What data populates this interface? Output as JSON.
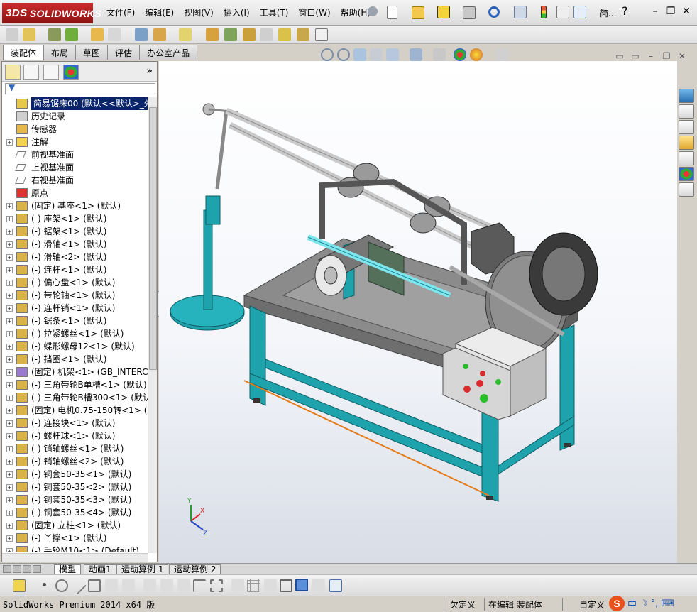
{
  "app": {
    "logo_text": "SOLIDWORKS",
    "logo_prefix": "3DS"
  },
  "menus": [
    "文件(F)",
    "编辑(E)",
    "视图(V)",
    "插入(I)",
    "工具(T)",
    "窗口(W)",
    "帮助(H)"
  ],
  "title_extra": "简...",
  "command_tabs": [
    {
      "label": "装配体",
      "active": true
    },
    {
      "label": "布局",
      "active": false
    },
    {
      "label": "草图",
      "active": false
    },
    {
      "label": "评估",
      "active": false
    },
    {
      "label": "办公室产品",
      "active": false
    }
  ],
  "feature_tree": [
    {
      "label": "简易锯床00 (默认<<默认>_外观",
      "icon": "assembly-icon",
      "root": true
    },
    {
      "label": "历史记录",
      "icon": "history-icon",
      "expand": false
    },
    {
      "label": "传感器",
      "icon": "sensor-icon",
      "expand": false
    },
    {
      "label": "注解",
      "icon": "annotation-icon",
      "expand": true
    },
    {
      "label": "前视基准面",
      "icon": "plane-icon",
      "expand": false
    },
    {
      "label": "上视基准面",
      "icon": "plane-icon",
      "expand": false
    },
    {
      "label": "右视基准面",
      "icon": "plane-icon",
      "expand": false
    },
    {
      "label": "原点",
      "icon": "origin-icon",
      "expand": false
    },
    {
      "label": "(固定) 基座<1> (默认)",
      "icon": "part-icon",
      "expand": true
    },
    {
      "label": "(-) 座架<1> (默认)",
      "icon": "part-icon",
      "expand": true
    },
    {
      "label": "(-) 锯架<1> (默认)",
      "icon": "part-icon",
      "expand": true
    },
    {
      "label": "(-) 滑轴<1> (默认)",
      "icon": "part-icon",
      "expand": true
    },
    {
      "label": "(-) 滑轴<2> (默认)",
      "icon": "part-icon",
      "expand": true
    },
    {
      "label": "(-) 连杆<1> (默认)",
      "icon": "part-icon",
      "expand": true
    },
    {
      "label": "(-) 偏心盘<1> (默认)",
      "icon": "part-icon",
      "expand": true
    },
    {
      "label": "(-) 带轮轴<1> (默认)",
      "icon": "part-icon",
      "expand": true
    },
    {
      "label": "(-) 连杆销<1> (默认)",
      "icon": "part-icon",
      "expand": true
    },
    {
      "label": "(-) 锯条<1> (默认)",
      "icon": "part-icon",
      "expand": true
    },
    {
      "label": "(-) 拉紧螺丝<1> (默认)",
      "icon": "part-icon",
      "expand": true
    },
    {
      "label": "(-) 蝶形螺母12<1> (默认)",
      "icon": "part-icon",
      "expand": true
    },
    {
      "label": "(-) 挡圈<1> (默认)",
      "icon": "part-icon",
      "expand": true
    },
    {
      "label": "(固定) 机架<1> (GB_INTERCHA",
      "icon": "subassembly-icon",
      "expand": true
    },
    {
      "label": "(-) 三角带轮B单槽<1> (默认)",
      "icon": "part-icon",
      "expand": true
    },
    {
      "label": "(-) 三角带轮B槽300<1> (默认",
      "icon": "part-icon",
      "expand": true
    },
    {
      "label": "(固定) 电机0.75-150转<1> (默",
      "icon": "part-icon",
      "expand": true
    },
    {
      "label": "(-) 连接块<1> (默认)",
      "icon": "part-icon",
      "expand": true
    },
    {
      "label": "(-) 螺杆球<1> (默认)",
      "icon": "part-icon",
      "expand": true
    },
    {
      "label": "(-) 销轴螺丝<1> (默认)",
      "icon": "part-icon",
      "expand": true
    },
    {
      "label": "(-) 销轴螺丝<2> (默认)",
      "icon": "part-icon",
      "expand": true
    },
    {
      "label": "(-) 铜套50-35<1> (默认)",
      "icon": "part-icon",
      "expand": true
    },
    {
      "label": "(-) 铜套50-35<2> (默认)",
      "icon": "part-icon",
      "expand": true
    },
    {
      "label": "(-) 铜套50-35<3> (默认)",
      "icon": "part-icon",
      "expand": true
    },
    {
      "label": "(-) 铜套50-35<4> (默认)",
      "icon": "part-icon",
      "expand": true
    },
    {
      "label": "(固定) 立柱<1> (默认)",
      "icon": "part-icon",
      "expand": true
    },
    {
      "label": "(-) 丫撑<1> (默认)",
      "icon": "part-icon",
      "expand": true
    },
    {
      "label": "(-) 手轮M10<1> (Default)",
      "icon": "part-icon",
      "expand": true
    }
  ],
  "bottom_tabs": [
    {
      "label": "模型",
      "active": true
    },
    {
      "label": "动画1",
      "active": false
    },
    {
      "label": "运动算例 1",
      "active": false
    },
    {
      "label": "运动算例 2",
      "active": false
    }
  ],
  "status": {
    "product": "SolidWorks Premium 2014 x64 版",
    "underdefined": "欠定义",
    "editing": "在编辑 装配体",
    "custom": "自定义"
  },
  "ime": {
    "logo": "S",
    "lang": "中"
  },
  "triad": {
    "x": "X",
    "y": "Y",
    "z": "Z"
  },
  "colors": {
    "frame": "#1ea3ad",
    "titlebar_logo": "#b31b1b",
    "selection": "#0a246a"
  }
}
